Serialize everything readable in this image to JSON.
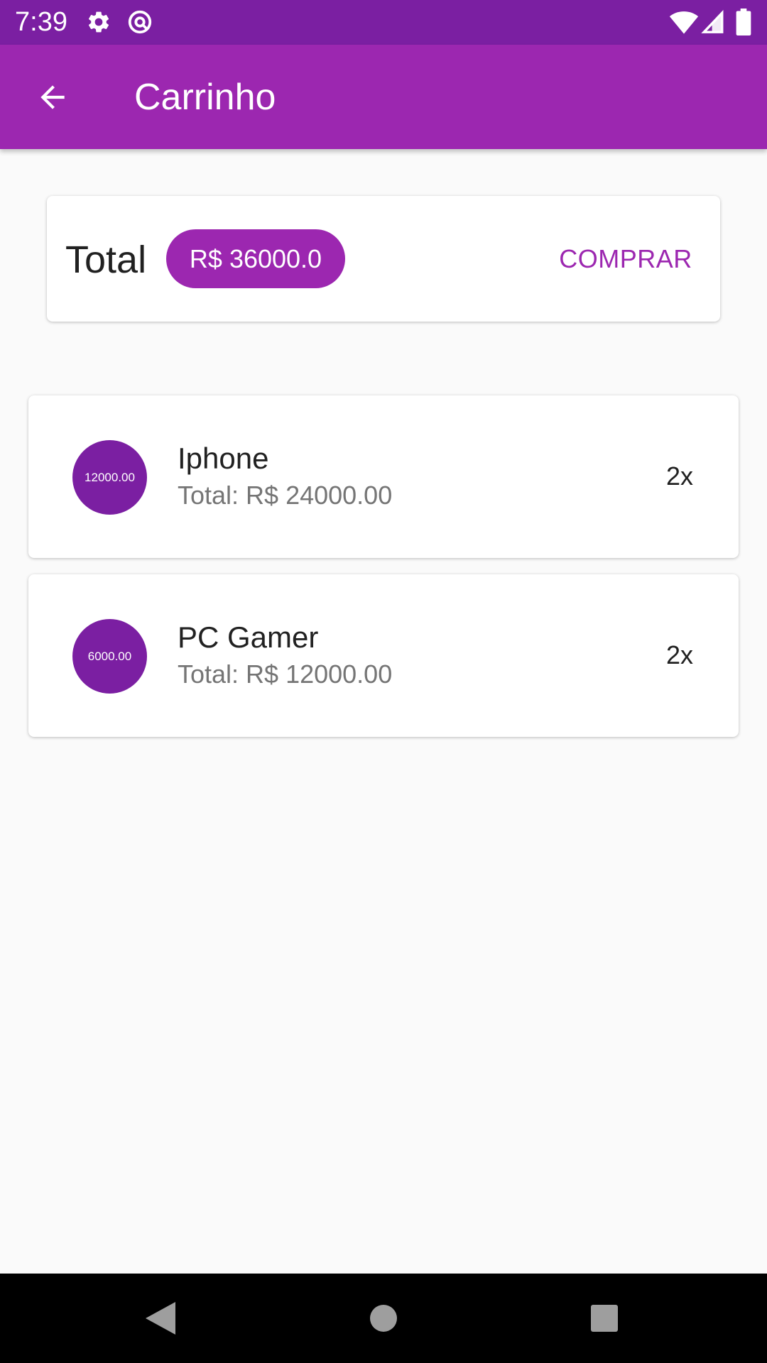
{
  "status_bar": {
    "time": "7:39",
    "icons": [
      "gear-icon",
      "at-sign-icon",
      "wifi-icon",
      "signal-icon",
      "battery-icon"
    ]
  },
  "app_bar": {
    "title": "Carrinho",
    "back_icon": "arrow-back-icon"
  },
  "summary": {
    "total_label": "Total",
    "total_value": "R$ 36000.0",
    "buy_label": "COMPRAR"
  },
  "items": [
    {
      "unit_price": "12000.00",
      "name": "Iphone",
      "total": "Total: R$ 24000.00",
      "quantity": "2x"
    },
    {
      "unit_price": "6000.00",
      "name": "PC Gamer",
      "total": "Total: R$ 12000.00",
      "quantity": "2x"
    }
  ],
  "nav_bar": {
    "icons": [
      "back-triangle-icon",
      "home-circle-icon",
      "recents-square-icon"
    ]
  },
  "colors": {
    "primary": "#9c27b0",
    "primary_dark": "#7b1fa2",
    "background": "#fafafa",
    "secondary_text": "#757575"
  }
}
